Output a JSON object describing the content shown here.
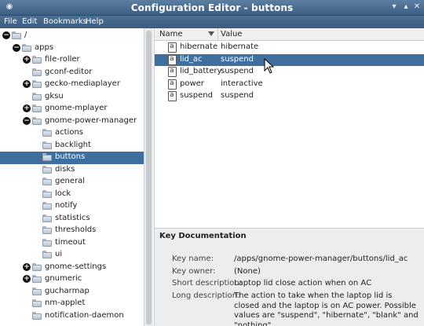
{
  "window": {
    "title": "Configuration Editor - buttons",
    "colors": {
      "titlebar": "#4a6d91",
      "selection": "#3e6f9e"
    }
  },
  "menubar": {
    "items": [
      "File",
      "Edit",
      "Bookmarks",
      "Help"
    ]
  },
  "tree": {
    "rows": [
      {
        "label": "/",
        "expander": "collapse"
      },
      {
        "label": "apps",
        "expander": "collapse"
      },
      {
        "label": "file-roller",
        "expander": "expand"
      },
      {
        "label": "gconf-editor",
        "expander": "none"
      },
      {
        "label": "gecko-mediaplayer",
        "expander": "expand"
      },
      {
        "label": "gksu",
        "expander": "none"
      },
      {
        "label": "gnome-mplayer",
        "expander": "expand"
      },
      {
        "label": "gnome-power-manager",
        "expander": "collapse"
      },
      {
        "label": "actions",
        "expander": "none"
      },
      {
        "label": "backlight",
        "expander": "none"
      },
      {
        "label": "buttons",
        "expander": "none",
        "selected": true
      },
      {
        "label": "disks",
        "expander": "none"
      },
      {
        "label": "general",
        "expander": "none"
      },
      {
        "label": "lock",
        "expander": "none"
      },
      {
        "label": "notify",
        "expander": "none"
      },
      {
        "label": "statistics",
        "expander": "none"
      },
      {
        "label": "thresholds",
        "expander": "none"
      },
      {
        "label": "timeout",
        "expander": "none"
      },
      {
        "label": "ui",
        "expander": "none"
      },
      {
        "label": "gnome-settings",
        "expander": "expand"
      },
      {
        "label": "gnumeric",
        "expander": "expand"
      },
      {
        "label": "gucharmap",
        "expander": "none"
      },
      {
        "label": "nm-applet",
        "expander": "none"
      },
      {
        "label": "notification-daemon",
        "expander": "none"
      }
    ]
  },
  "keylist": {
    "headers": {
      "name": "Name",
      "value": "Value"
    },
    "rows": [
      {
        "name": "hibernate",
        "value": "hibernate"
      },
      {
        "name": "lid_ac",
        "value": "suspend",
        "selected": true
      },
      {
        "name": "lid_battery",
        "value": "suspend"
      },
      {
        "name": "power",
        "value": "interactive"
      },
      {
        "name": "suspend",
        "value": "suspend"
      }
    ]
  },
  "doc": {
    "title": "Key Documentation",
    "key_name_label": "Key name:",
    "key_name": "/apps/gnome-power-manager/buttons/lid_ac",
    "key_owner_label": "Key owner:",
    "key_owner": "(None)",
    "short_label": "Short description:",
    "short": "Laptop lid close action when on AC",
    "long_label": "Long description:",
    "long": "The action to take when the laptop lid is closed and the laptop is on AC power. Possible values are \"suspend\", \"hibernate\", \"blank\" and \"nothing\"."
  }
}
